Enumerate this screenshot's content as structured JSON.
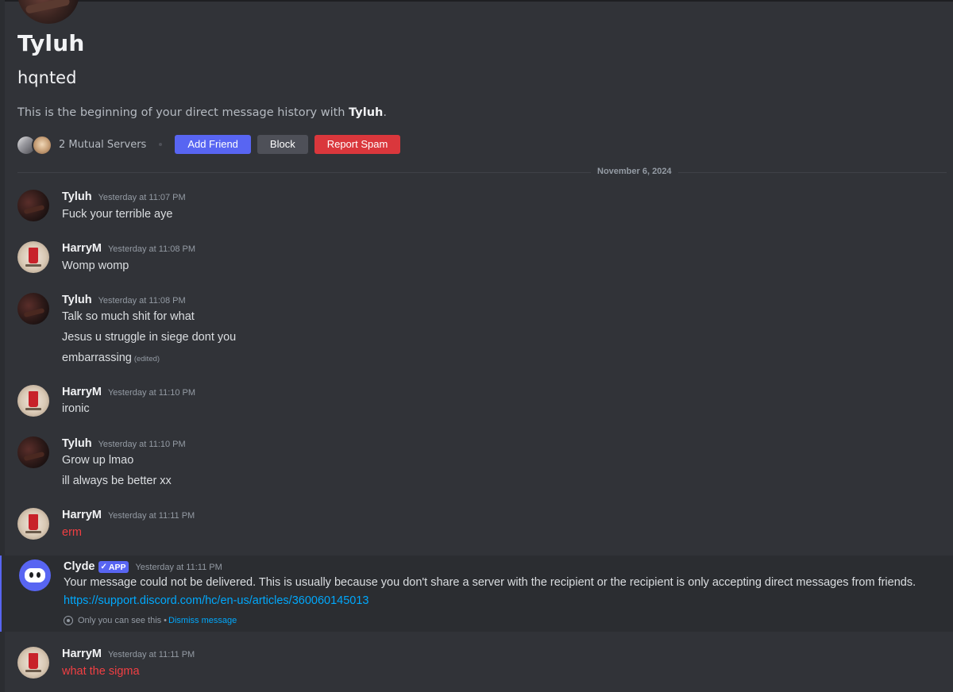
{
  "profile": {
    "display_name": "Tyluh",
    "username": "hqnted",
    "intro_prefix": "This is the beginning of your direct message history with ",
    "intro_name": "Tyluh",
    "intro_suffix": ".",
    "mutual_servers": "2 Mutual Servers"
  },
  "actions": {
    "add_friend": "Add Friend",
    "block": "Block",
    "report_spam": "Report Spam"
  },
  "divider": {
    "date": "November 6, 2024"
  },
  "messages": [
    {
      "author": "Tyluh",
      "time": "Yesterday at 11:07 PM",
      "lines": [
        "Fuck your terrible aye"
      ]
    },
    {
      "author": "HarryM",
      "time": "Yesterday at 11:08 PM",
      "lines": [
        "Womp womp"
      ]
    },
    {
      "author": "Tyluh",
      "time": "Yesterday at 11:08 PM",
      "lines": [
        "Talk so much shit for what",
        "Jesus u struggle in siege dont you",
        "embarrassing"
      ],
      "edited": "(edited)"
    },
    {
      "author": "HarryM",
      "time": "Yesterday at 11:10 PM",
      "lines": [
        "ironic"
      ]
    },
    {
      "author": "Tyluh",
      "time": "Yesterday at 11:10 PM",
      "lines": [
        "Grow up lmao",
        "ill always be better xx"
      ]
    },
    {
      "author": "HarryM",
      "time": "Yesterday at 11:11 PM",
      "lines": [
        "erm"
      ]
    },
    {
      "author": "Clyde",
      "badge": "APP",
      "time": "Yesterday at 11:11 PM",
      "lines": [
        "Your message could not be delivered. This is usually because you don't share a server with the recipient or the recipient is only accepting direct messages from friends."
      ],
      "link": "https://support.discord.com/hc/en-us/articles/360060145013",
      "ephemeral_note": "Only you can see this",
      "ephemeral_sep": "•",
      "dismiss": "Dismiss message"
    },
    {
      "author": "HarryM",
      "time": "Yesterday at 11:11 PM",
      "lines": [
        "what the sigma"
      ]
    }
  ],
  "colors": {
    "background": "#313338",
    "blurple": "#5865f2",
    "danger": "#da373c",
    "red_text": "#f23f43",
    "link": "#00a8fc"
  },
  "icons": {
    "badge_check": "checkmark-icon",
    "ephemeral": "eye-icon"
  }
}
